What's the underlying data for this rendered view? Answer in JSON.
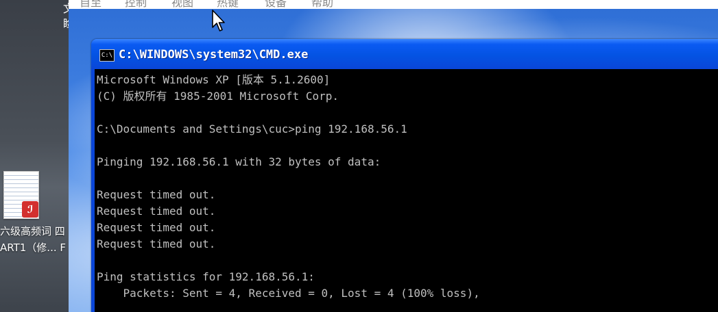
{
  "host": {
    "top_fragment": "文\n睑",
    "desktop_icon": {
      "label": "六级高频词 四\nART1（修... F",
      "badge_icon": "pdf-icon"
    }
  },
  "vm": {
    "menu_items": [
      "自至",
      "控制",
      "视图",
      "热键",
      "设备",
      "帮助"
    ]
  },
  "cmd": {
    "title": "C:\\WINDOWS\\system32\\CMD.exe",
    "icon": "cmd-icon",
    "icon_text": "C:\\",
    "lines": [
      "Microsoft Windows XP [版本 5.1.2600]",
      "(C) 版权所有 1985-2001 Microsoft Corp.",
      "",
      "C:\\Documents and Settings\\cuc>ping 192.168.56.1",
      "",
      "Pinging 192.168.56.1 with 32 bytes of data:",
      "",
      "Request timed out.",
      "Request timed out.",
      "Request timed out.",
      "Request timed out.",
      "",
      "Ping statistics for 192.168.56.1:",
      "    Packets: Sent = 4, Received = 0, Lost = 4 (100% loss),"
    ]
  },
  "colors": {
    "console_bg": "#000000",
    "console_text": "#c0c0c0",
    "titlebar_blue": "#0453e3"
  }
}
